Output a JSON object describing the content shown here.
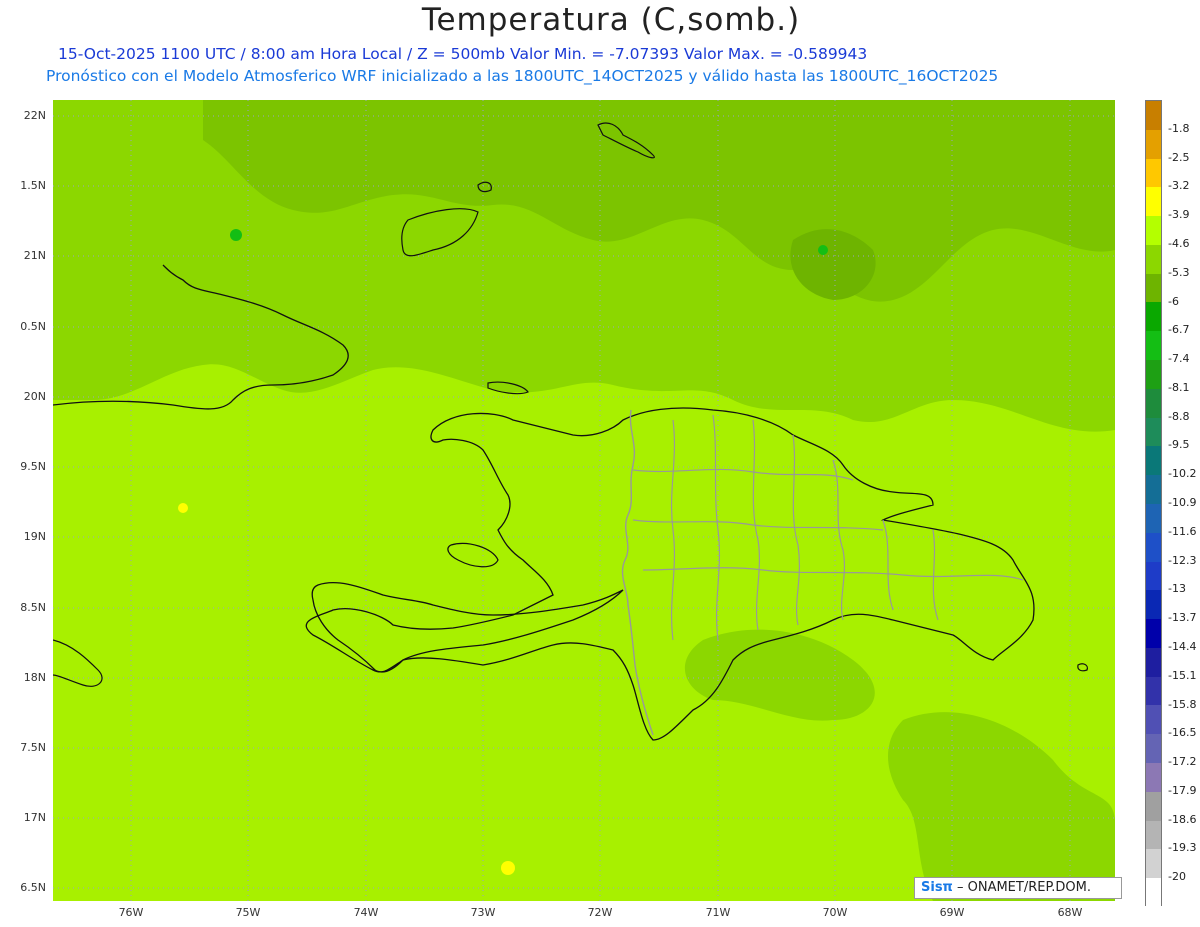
{
  "title": "Temperatura (C,somb.)",
  "subtitle_line1": "15-Oct-2025  1100 UTC / 8:00 am Hora Local / Z = 500mb  Valor Min. = -7.07393  Valor Max. = -0.589943",
  "subtitle_line2": "Pronóstico con el Modelo Atmosferico WRF inicializado a las 1800UTC_14OCT2025 y válido hasta las  1800UTC_16OCT2025",
  "credit": {
    "logo": "Sisπ",
    "text": " – ONAMET/REP.DOM."
  },
  "map_data": {
    "variable": "Temperatura (C,somb.)",
    "pressure_level": "500mb",
    "value_min": -7.07393,
    "value_max": -0.589943,
    "lon_labels": [
      "76W",
      "75W",
      "74W",
      "73W",
      "72W",
      "71W",
      "70W",
      "69W",
      "68W"
    ],
    "lat_labels": [
      "22N",
      "1.5N",
      "21N",
      "0.5N",
      "20N",
      "9.5N",
      "19N",
      "8.5N",
      "18N",
      "7.5N",
      "17N",
      "6.5N"
    ],
    "grid": "dotted"
  },
  "colorbar": {
    "labels": [
      "-1.8",
      "-2.5",
      "-3.2",
      "-3.9",
      "-4.6",
      "-5.3",
      "-6",
      "-6.7",
      "-7.4",
      "-8.1",
      "-8.8",
      "-9.5",
      "-10.2",
      "-10.9",
      "-11.6",
      "-12.3",
      "-13",
      "-13.7",
      "-14.4",
      "-15.1",
      "-15.8",
      "-16.5",
      "-17.2",
      "-17.9",
      "-18.6",
      "-19.3",
      "-20"
    ],
    "colors": [
      "#c87f00",
      "#e4a000",
      "#ffc800",
      "#ffff00",
      "#b4ff00",
      "#8cd700",
      "#6eb400",
      "#0aa800",
      "#14be14",
      "#1ea014",
      "#1e8c3c",
      "#1e8c5a",
      "#0a7878",
      "#146e96",
      "#1e64b4",
      "#1e50c8",
      "#1e3cc8",
      "#0a28b4",
      "#0000aa",
      "#1e1ea0",
      "#3232aa",
      "#5050b4",
      "#6464b4",
      "#8c78b4",
      "#a0a0a0",
      "#b4b4b4",
      "#d2d2d2",
      "#ffffff"
    ]
  }
}
